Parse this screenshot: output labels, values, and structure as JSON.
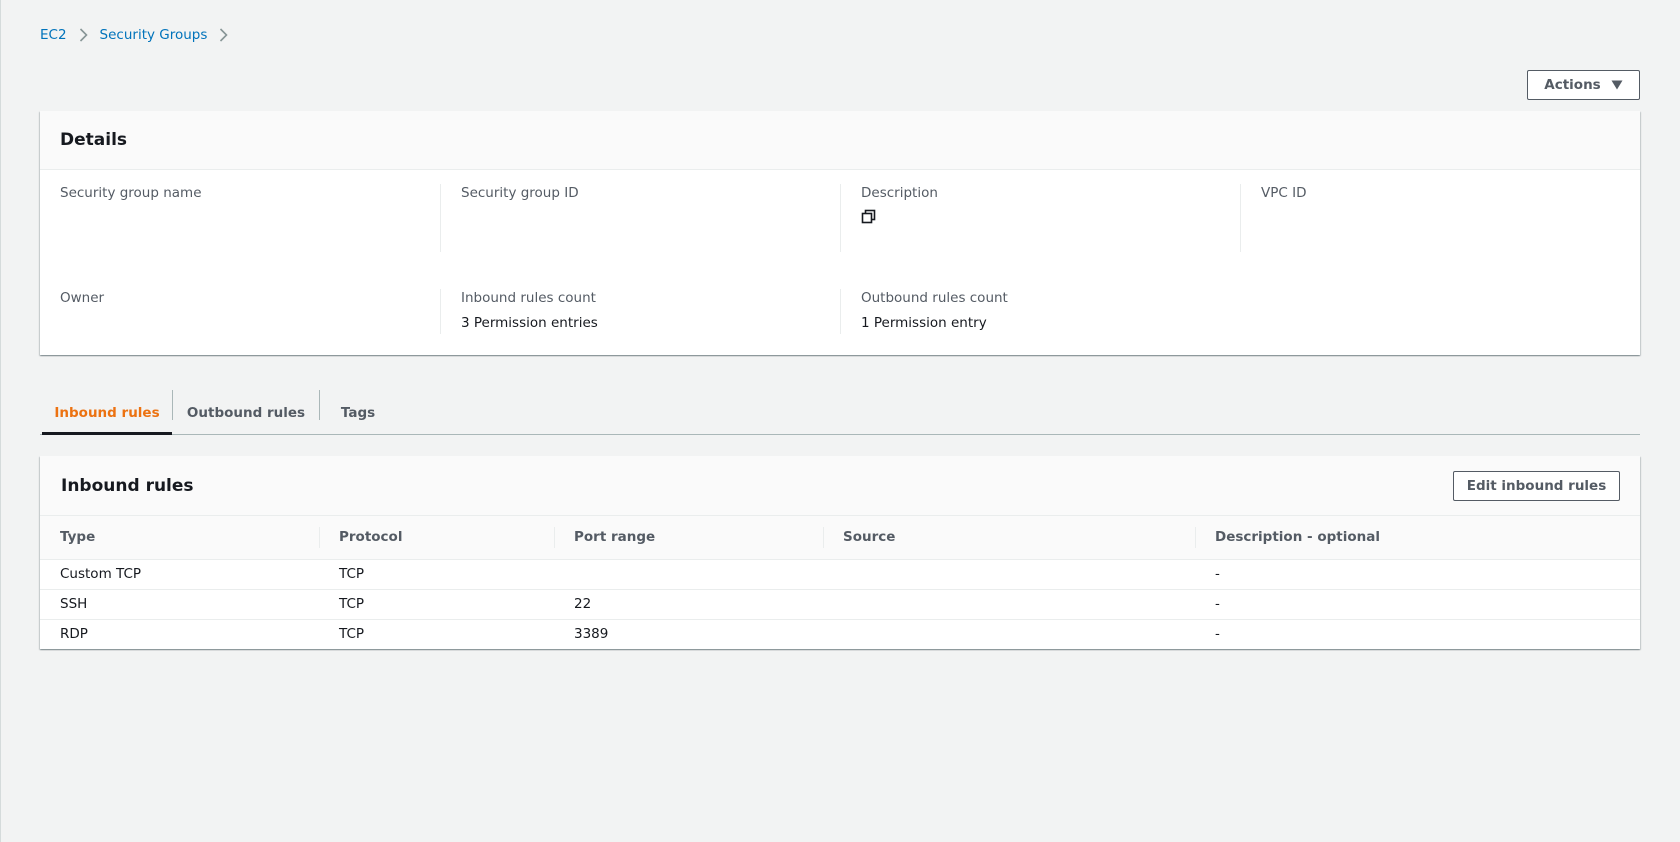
{
  "breadcrumb": [
    {
      "label": "EC2"
    },
    {
      "label": "Security Groups"
    }
  ],
  "actions": {
    "label": "Actions"
  },
  "details": {
    "title": "Details",
    "security_group_name": {
      "label": "Security group name",
      "value": ""
    },
    "security_group_id": {
      "label": "Security group ID",
      "value": ""
    },
    "description": {
      "label": "Description",
      "value": "",
      "icon": "copy-icon"
    },
    "vpc_id": {
      "label": "VPC ID",
      "value": ""
    },
    "owner": {
      "label": "Owner",
      "value": ""
    },
    "inbound_rules_count": {
      "label": "Inbound rules count",
      "value": "3 Permission entries"
    },
    "outbound_rules_count": {
      "label": "Outbound rules count",
      "value": "1 Permission entry"
    }
  },
  "tabs": [
    {
      "label": "Inbound rules",
      "active": true
    },
    {
      "label": "Outbound rules",
      "active": false
    },
    {
      "label": "Tags",
      "active": false
    }
  ],
  "inbound_rules": {
    "title": "Inbound rules",
    "edit_button": "Edit inbound rules",
    "columns": [
      "Type",
      "Protocol",
      "Port range",
      "Source",
      "Description - optional"
    ],
    "rows": [
      [
        "Custom TCP",
        "TCP",
        "",
        "",
        "-"
      ],
      [
        "SSH",
        "TCP",
        "22",
        "",
        "-"
      ],
      [
        "RDP",
        "TCP",
        "3389",
        "",
        "-"
      ]
    ]
  },
  "colors": {
    "link": "#0073bb",
    "active_tab": "#ec7211",
    "text": "#16191f",
    "secondary_text": "#545b64",
    "background": "#f2f3f3"
  }
}
